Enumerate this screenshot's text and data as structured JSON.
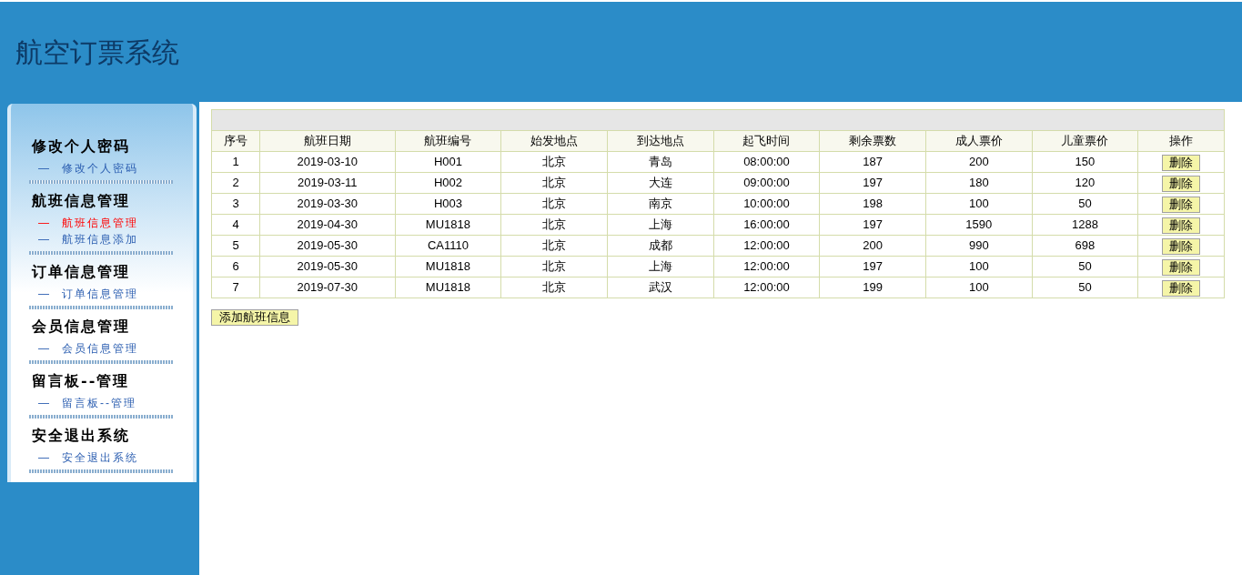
{
  "header": {
    "title": "航空订票系统"
  },
  "sidebar": {
    "sections": [
      {
        "heading": "修改个人密码",
        "links": [
          {
            "marker": "—",
            "label": "修改个人密码",
            "selected": false
          }
        ]
      },
      {
        "heading": "航班信息管理",
        "links": [
          {
            "marker": "—",
            "label": "航班信息管理",
            "selected": true
          },
          {
            "marker": "—",
            "label": "航班信息添加",
            "selected": false
          }
        ]
      },
      {
        "heading": "订单信息管理",
        "links": [
          {
            "marker": "—",
            "label": "订单信息管理",
            "selected": false
          }
        ]
      },
      {
        "heading": "会员信息管理",
        "links": [
          {
            "marker": "—",
            "label": "会员信息管理",
            "selected": false
          }
        ]
      },
      {
        "heading": "留言板--管理",
        "links": [
          {
            "marker": "—",
            "label": "留言板--管理",
            "selected": false
          }
        ]
      },
      {
        "heading": "安全退出系统",
        "links": [
          {
            "marker": "—",
            "label": "安全退出系统",
            "selected": false
          }
        ]
      }
    ]
  },
  "table": {
    "columns": [
      "序号",
      "航班日期",
      "航班编号",
      "始发地点",
      "到达地点",
      "起飞时间",
      "剩余票数",
      "成人票价",
      "儿童票价",
      "操作"
    ],
    "rows": [
      {
        "cells": [
          "1",
          "2019-03-10",
          "H001",
          "北京",
          "青岛",
          "08:00:00",
          "187",
          "200",
          "150"
        ],
        "action": "删除"
      },
      {
        "cells": [
          "2",
          "2019-03-11",
          "H002",
          "北京",
          "大连",
          "09:00:00",
          "197",
          "180",
          "120"
        ],
        "action": "删除"
      },
      {
        "cells": [
          "3",
          "2019-03-30",
          "H003",
          "北京",
          "南京",
          "10:00:00",
          "198",
          "100",
          "50"
        ],
        "action": "删除"
      },
      {
        "cells": [
          "4",
          "2019-04-30",
          "MU1818",
          "北京",
          "上海",
          "16:00:00",
          "197",
          "1590",
          "1288"
        ],
        "action": "删除"
      },
      {
        "cells": [
          "5",
          "2019-05-30",
          "CA1110",
          "北京",
          "成都",
          "12:00:00",
          "200",
          "990",
          "698"
        ],
        "action": "删除"
      },
      {
        "cells": [
          "6",
          "2019-05-30",
          "MU1818",
          "北京",
          "上海",
          "12:00:00",
          "197",
          "100",
          "50"
        ],
        "action": "删除"
      },
      {
        "cells": [
          "7",
          "2019-07-30",
          "MU1818",
          "北京",
          "武汉",
          "12:00:00",
          "199",
          "100",
          "50"
        ],
        "action": "删除"
      }
    ]
  },
  "add_button": "添加航班信息"
}
